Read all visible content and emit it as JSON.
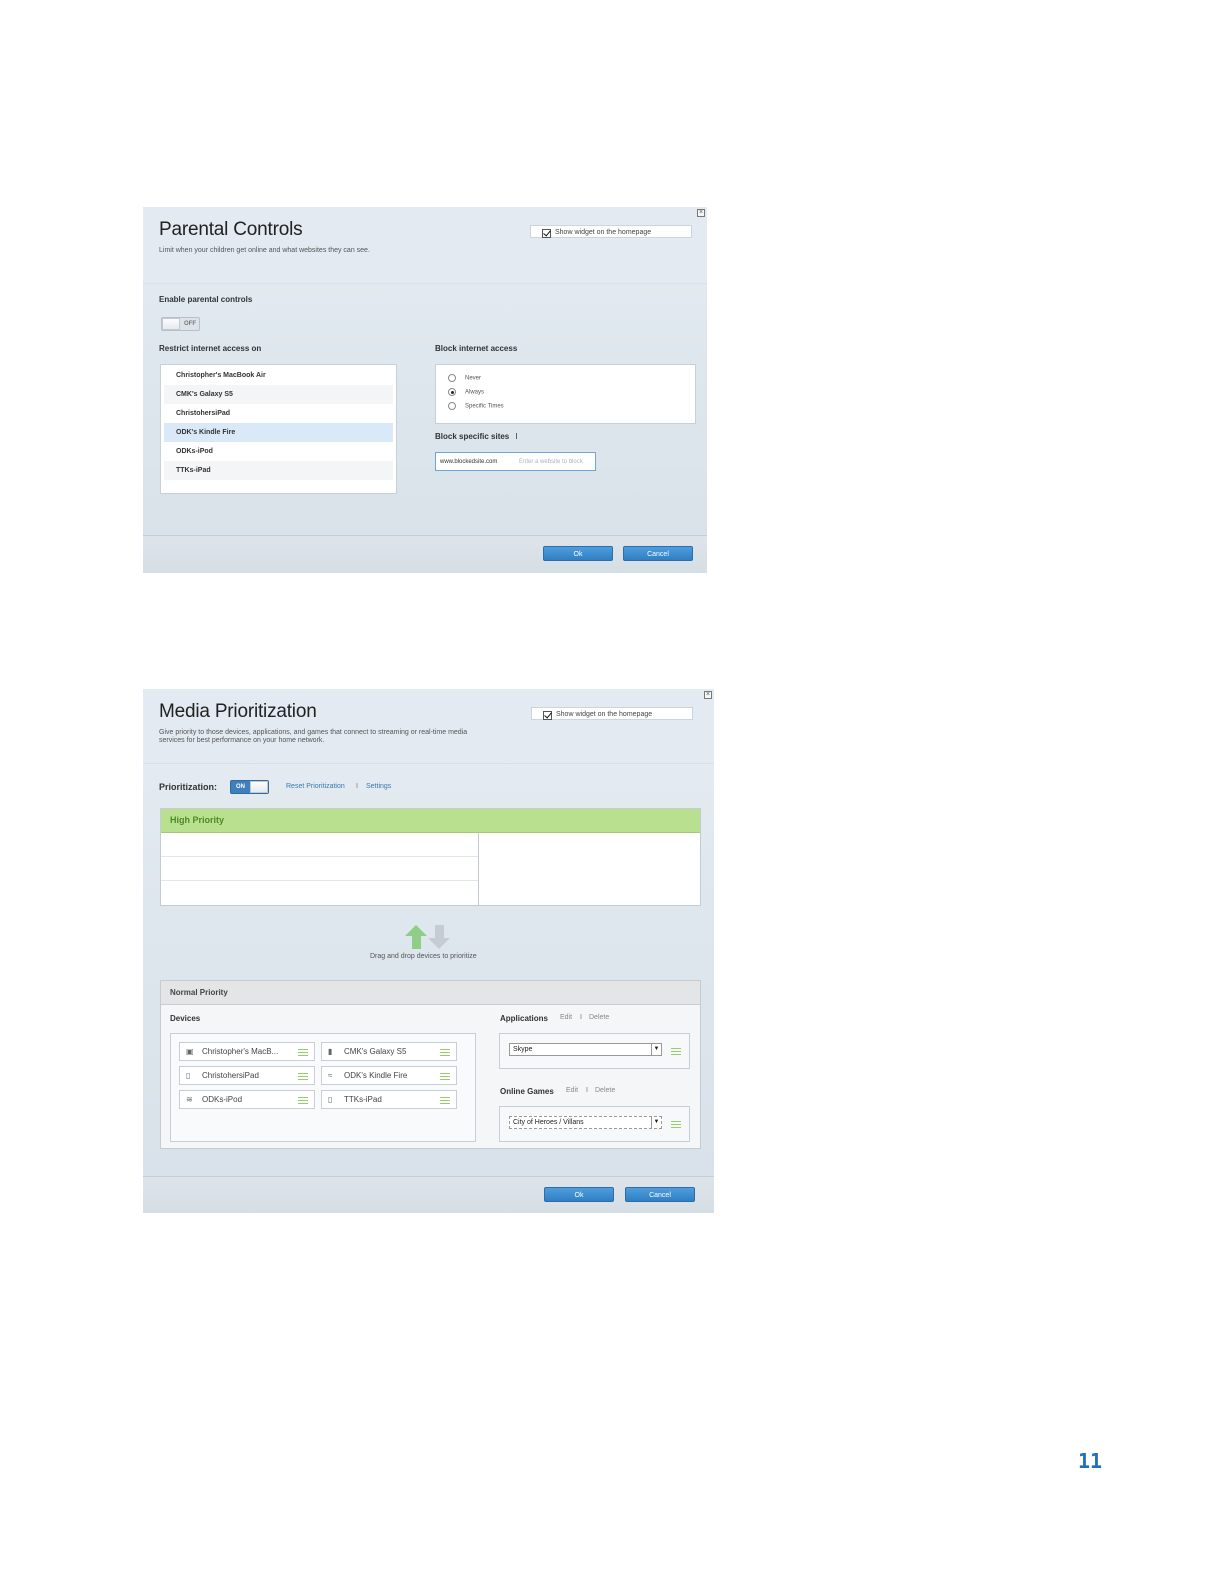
{
  "parental": {
    "title": "Parental Controls",
    "subtitle": "Limit when your children get online and what websites they can see.",
    "widget_label": "Show widget on the homepage",
    "enable_label": "Enable parental controls",
    "toggle_text": "OFF",
    "restrict_label": "Restrict internet access on",
    "devices": [
      "Christopher's MacBook Air",
      "CMK's Galaxy S5",
      "ChristohersiPad",
      "ODK's Kindle Fire",
      "ODKs-iPod",
      "TTKs-iPad"
    ],
    "selected_device": "ODK's Kindle Fire",
    "block_label": "Block internet access",
    "options": [
      "Never",
      "Always",
      "Specific Times"
    ],
    "selected_option": "Always",
    "block_sites_label": "Block specific sites",
    "block_sites_sep": "I",
    "site_value": "www.blockedsite.com",
    "site_placeholder": "Enter a website to block",
    "ok_label": "Ok",
    "cancel_label": "Cancel"
  },
  "media": {
    "title": "Media Prioritization",
    "subtitle_1": "Give priority to those devices, applications, and games that connect to streaming or real-time media",
    "subtitle_2": "services for best performance on your home network.",
    "widget_label": "Show widget on the homepage",
    "prioritization_label": "Prioritization:",
    "toggle_text": "ON",
    "reset_link": "Reset Prioritization",
    "link_sep": "I",
    "settings_link": "Settings",
    "high_priority_label": "High Priority",
    "drag_hint": "Drag and drop devices to prioritize",
    "normal_priority_label": "Normal Priority",
    "devices_label": "Devices",
    "devices": [
      {
        "name": "Christopher's MacB...",
        "icon": "laptop-icon"
      },
      {
        "name": "CMK's Galaxy S5",
        "icon": "phone-icon"
      },
      {
        "name": "ChristohersiPad",
        "icon": "tablet-icon"
      },
      {
        "name": "ODK's Kindle Fire",
        "icon": "router-icon"
      },
      {
        "name": "ODKs-iPod",
        "icon": "ipod-icon"
      },
      {
        "name": "TTKs-iPad",
        "icon": "tablet-icon"
      }
    ],
    "applications_label": "Applications",
    "edit_label": "Edit",
    "delete_label": "Delete",
    "application_value": "Skype",
    "online_games_label": "Online Games",
    "game_value": "City of Heroes / Villans",
    "ok_label": "Ok",
    "cancel_label": "Cancel"
  },
  "page_number": "11",
  "colors": {
    "accent": "#2f7fc4",
    "high_priority": "#b8e08e",
    "page_number": "#1e6fc1"
  }
}
